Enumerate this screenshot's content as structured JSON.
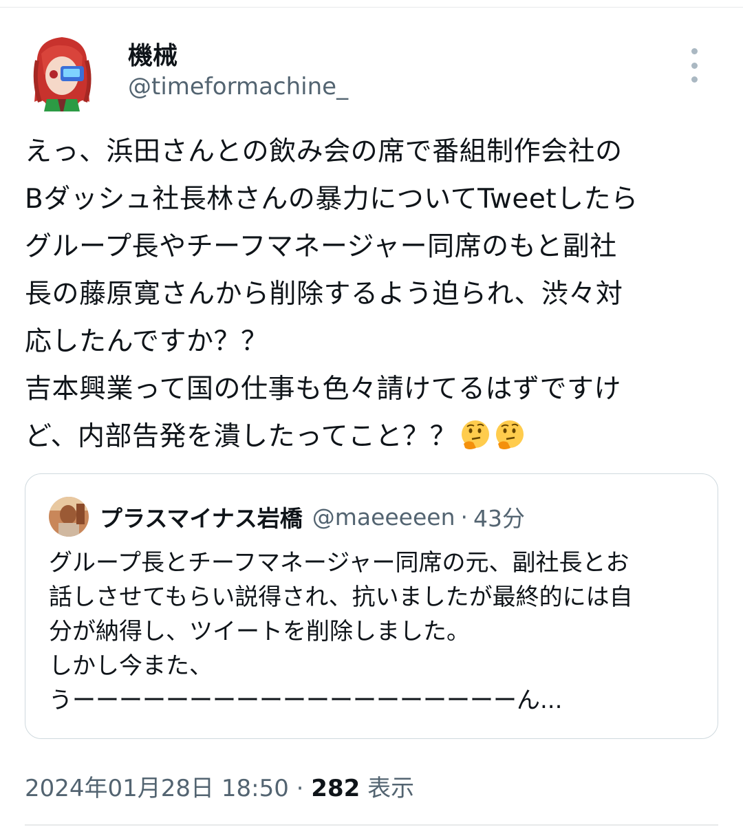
{
  "author": {
    "display_name": "機械",
    "handle": "@timeformachine_"
  },
  "tweet": {
    "text_lines": [
      "えっ、浜田さんとの飲み会の席で番組制作会社の",
      "Bダッシュ社長林さんの暴力についてTweetしたら",
      "グループ長やチーフマネージャー同席のもと副社",
      "長の藤原寛さんから削除するよう迫られ、渋々対",
      "応したんですか？？",
      "吉本興業って国の仕事も色々請けてるはずですけ",
      "ど、内部告発を潰したってこと？？"
    ],
    "emoji": [
      "thinking-face",
      "thinking-face"
    ]
  },
  "quote": {
    "display_name": "プラスマイナス岩橋",
    "handle": "@maeeeeen",
    "separator": "·",
    "time": "43分",
    "text": "グループ長とチーフマネージャー同席の元、副社長とお\n話しさせてもらい説得され、抗いましたが最終的には自\n分が納得し、ツイートを削除しました。\nしかし今また、\nうーーーーーーーーーーーーーーーーーーーん..."
  },
  "meta": {
    "timestamp": "2024年01月28日 18:50",
    "separator": "·",
    "views": "282",
    "views_label": "表示"
  },
  "colors": {
    "text_primary": "#0f1419",
    "text_secondary": "#536471",
    "border": "#cfd9de"
  }
}
